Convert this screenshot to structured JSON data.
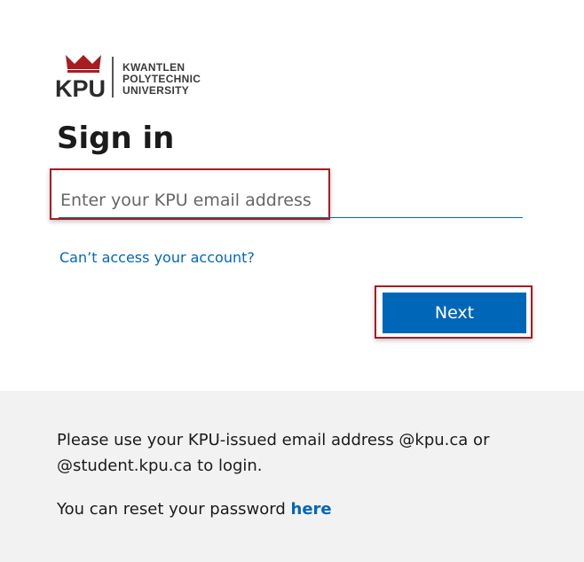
{
  "logo": {
    "abbr": "KPU",
    "name_lines": [
      "KWANTLEN",
      "POLYTECHNIC",
      "UNIVERSITY"
    ],
    "brand_color": "#a81c22"
  },
  "signin": {
    "title": "Sign in",
    "email_placeholder": "Enter your KPU email address",
    "email_value": "",
    "help_link": "Can’t access your account?",
    "next_label": "Next"
  },
  "footer": {
    "notice": "Please use your KPU-issued email address @kpu.ca or @student.kpu.ca to login.",
    "reset_prefix": "You can reset your password",
    "reset_link": "here"
  },
  "colors": {
    "accent": "#0067b8",
    "highlight": "#a81c22",
    "footer_bg": "#f2f2f2"
  }
}
